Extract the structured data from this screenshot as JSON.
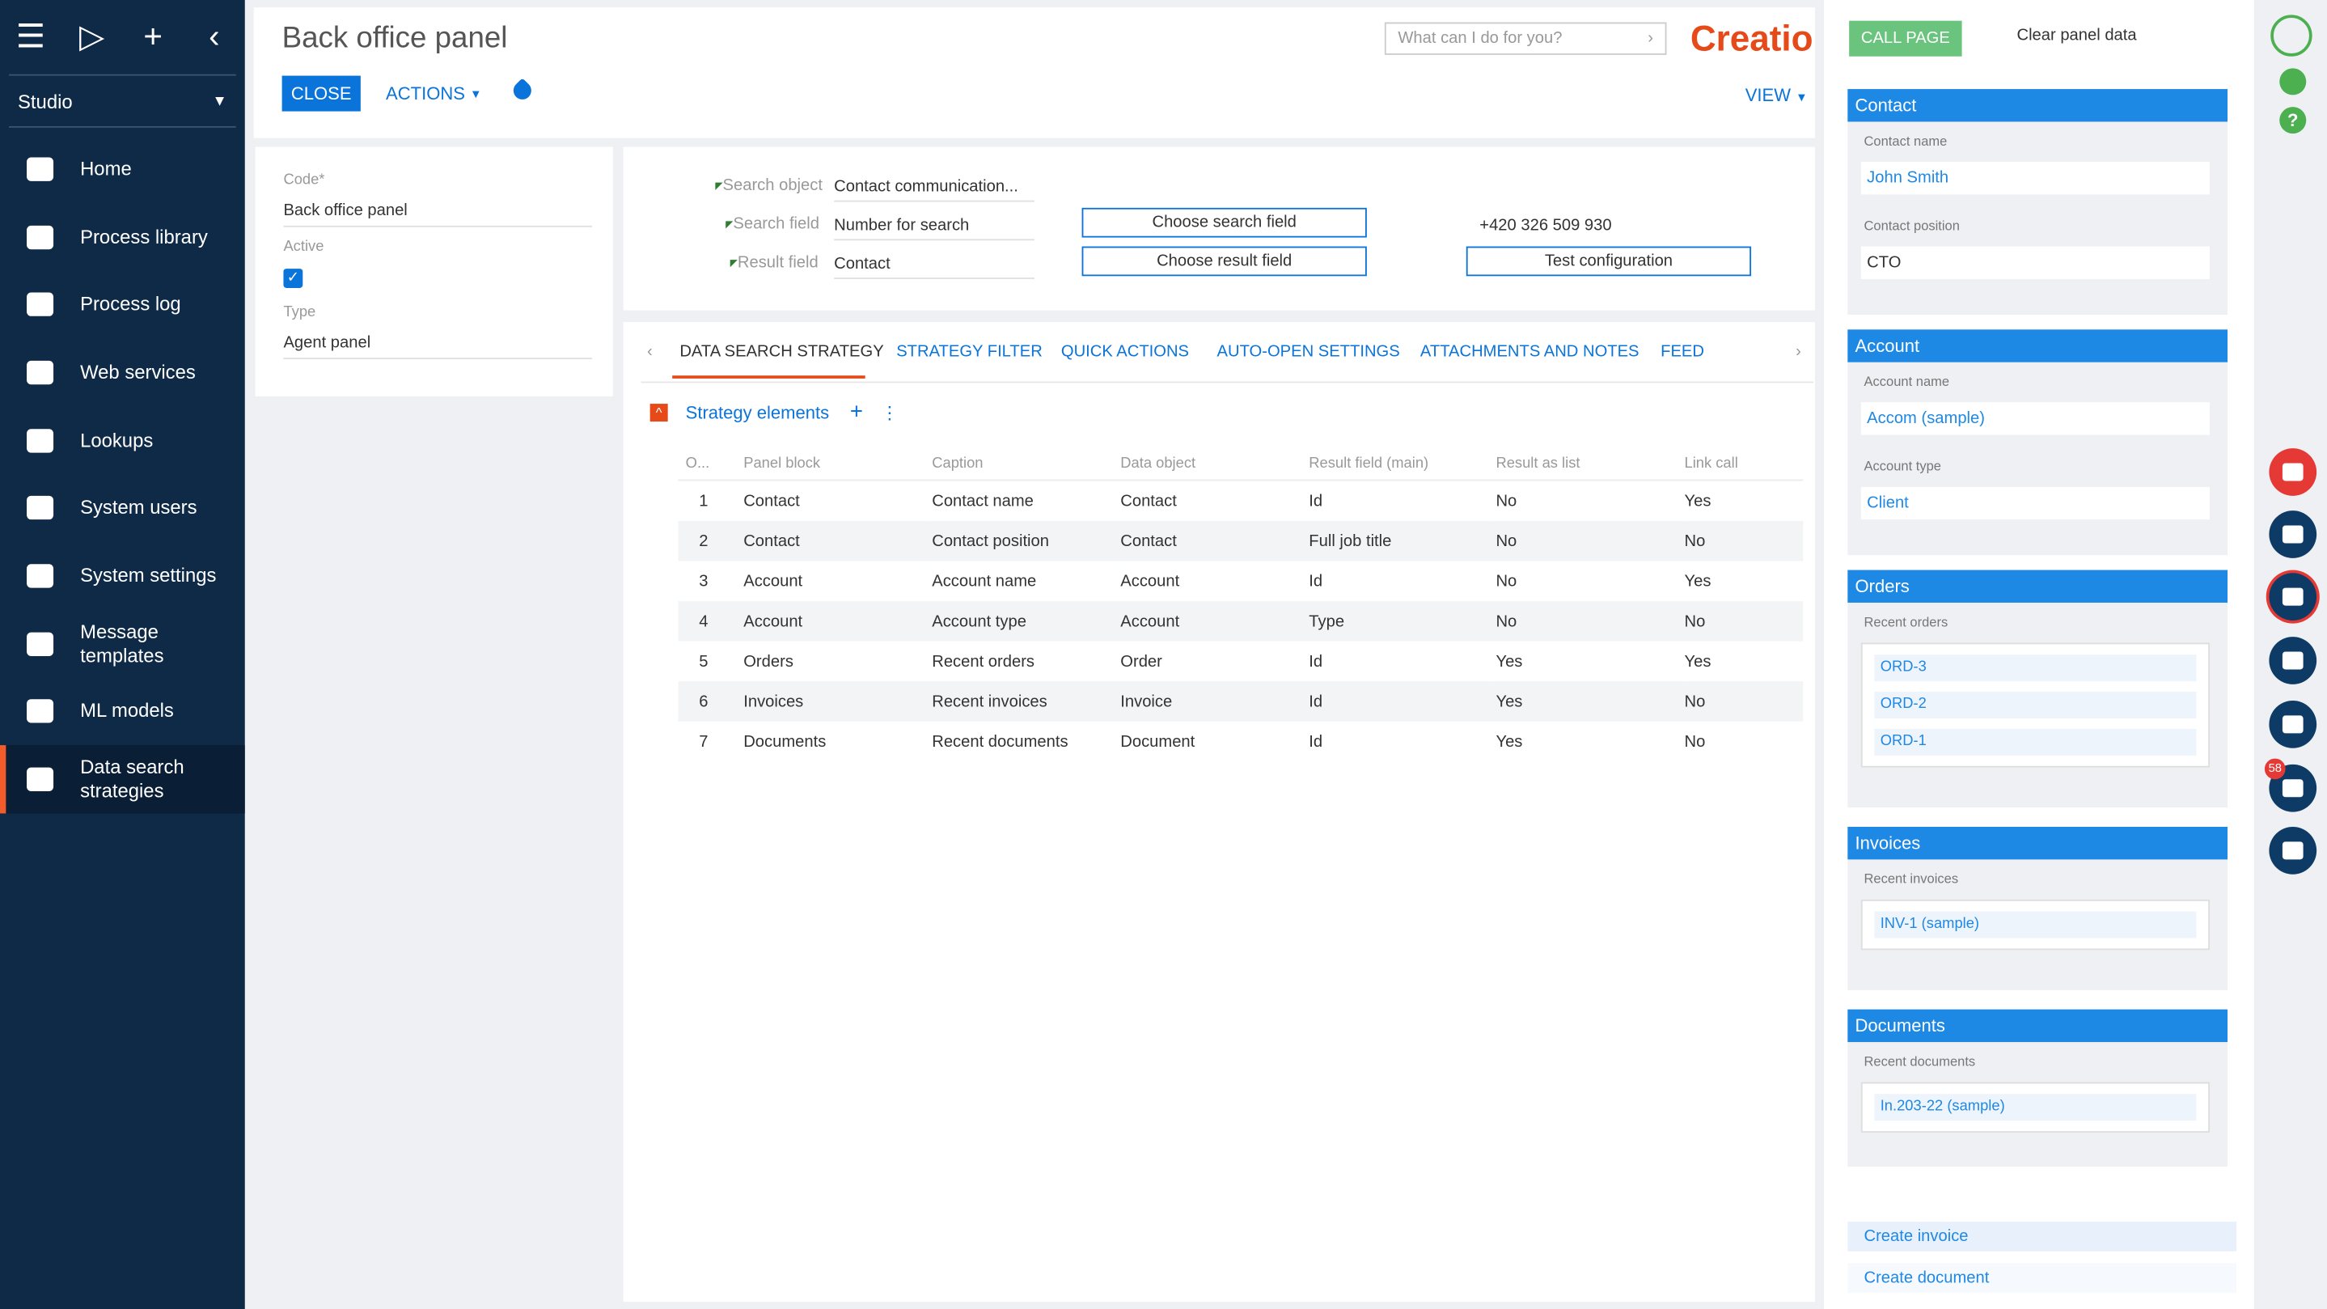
{
  "nav": {
    "studio": "Studio",
    "items": [
      {
        "label": "Home",
        "icon": "home-icon"
      },
      {
        "label": "Process library",
        "icon": "process-library-icon"
      },
      {
        "label": "Process log",
        "icon": "process-log-icon"
      },
      {
        "label": "Web services",
        "icon": "cloud-icon"
      },
      {
        "label": "Lookups",
        "icon": "lookups-icon"
      },
      {
        "label": "System users",
        "icon": "users-icon"
      },
      {
        "label": "System settings",
        "icon": "settings-icon"
      },
      {
        "label": "Message templates",
        "icon": "email-template-icon"
      },
      {
        "label": "ML models",
        "icon": "ml-icon"
      },
      {
        "label": "Data search strategies",
        "icon": "search-user-icon"
      }
    ]
  },
  "header": {
    "title": "Back office panel",
    "close": "CLOSE",
    "actions": "ACTIONS",
    "search_placeholder": "What can I do for you?",
    "logo": "Creatio",
    "view": "VIEW"
  },
  "left_card": {
    "code_label": "Code*",
    "code_value": "Back office panel",
    "active_label": "Active",
    "type_label": "Type",
    "type_value": "Agent panel"
  },
  "config": {
    "search_object_label": "Search object",
    "search_object_value": "Contact communication...",
    "search_field_label": "Search field",
    "search_field_value": "Number for search",
    "result_field_label": "Result field",
    "result_field_value": "Contact",
    "choose_search": "Choose search field",
    "choose_result": "Choose result field",
    "phone": "+420 326 509 930",
    "test": "Test configuration"
  },
  "tabs": [
    "DATA SEARCH STRATEGY",
    "STRATEGY FILTER",
    "QUICK ACTIONS",
    "AUTO-OPEN SETTINGS",
    "ATTACHMENTS AND NOTES",
    "FEED"
  ],
  "strategy": {
    "title": "Strategy elements",
    "columns": [
      "O...",
      "Panel block",
      "Caption",
      "Data object",
      "Result field (main)",
      "Result as list",
      "Link call"
    ],
    "rows": [
      [
        "1",
        "Contact",
        "Contact name",
        "Contact",
        "Id",
        "No",
        "Yes"
      ],
      [
        "2",
        "Contact",
        "Contact position",
        "Contact",
        "Full job title",
        "No",
        "No"
      ],
      [
        "3",
        "Account",
        "Account name",
        "Account",
        "Id",
        "No",
        "Yes"
      ],
      [
        "4",
        "Account",
        "Account type",
        "Account",
        "Type",
        "No",
        "No"
      ],
      [
        "5",
        "Orders",
        "Recent orders",
        "Order",
        "Id",
        "Yes",
        "Yes"
      ],
      [
        "6",
        "Invoices",
        "Recent invoices",
        "Invoice",
        "Id",
        "Yes",
        "No"
      ],
      [
        "7",
        "Documents",
        "Recent documents",
        "Document",
        "Id",
        "Yes",
        "No"
      ]
    ]
  },
  "panel": {
    "call_page": "CALL PAGE",
    "clear": "Clear panel data",
    "contact": {
      "header": "Contact",
      "name_label": "Contact name",
      "name": "John Smith",
      "position_label": "Contact position",
      "position": "CTO"
    },
    "account": {
      "header": "Account",
      "name_label": "Account name",
      "name": "Accom (sample)",
      "type_label": "Account type",
      "type": "Client"
    },
    "orders": {
      "header": "Orders",
      "label": "Recent orders",
      "items": [
        "ORD-3",
        "ORD-2",
        "ORD-1"
      ]
    },
    "invoices": {
      "header": "Invoices",
      "label": "Recent invoices",
      "items": [
        "INV-1 (sample)"
      ]
    },
    "documents": {
      "header": "Documents",
      "label": "Recent documents",
      "items": [
        "In.203-22 (sample)"
      ]
    },
    "create_invoice": "Create invoice",
    "create_document": "Create document"
  },
  "notifications_count": "58",
  "colors": {
    "brand": "#e64a19",
    "accent": "#0a74da",
    "nav_bg": "#0e2a47",
    "call_page": "#6bc47d"
  }
}
